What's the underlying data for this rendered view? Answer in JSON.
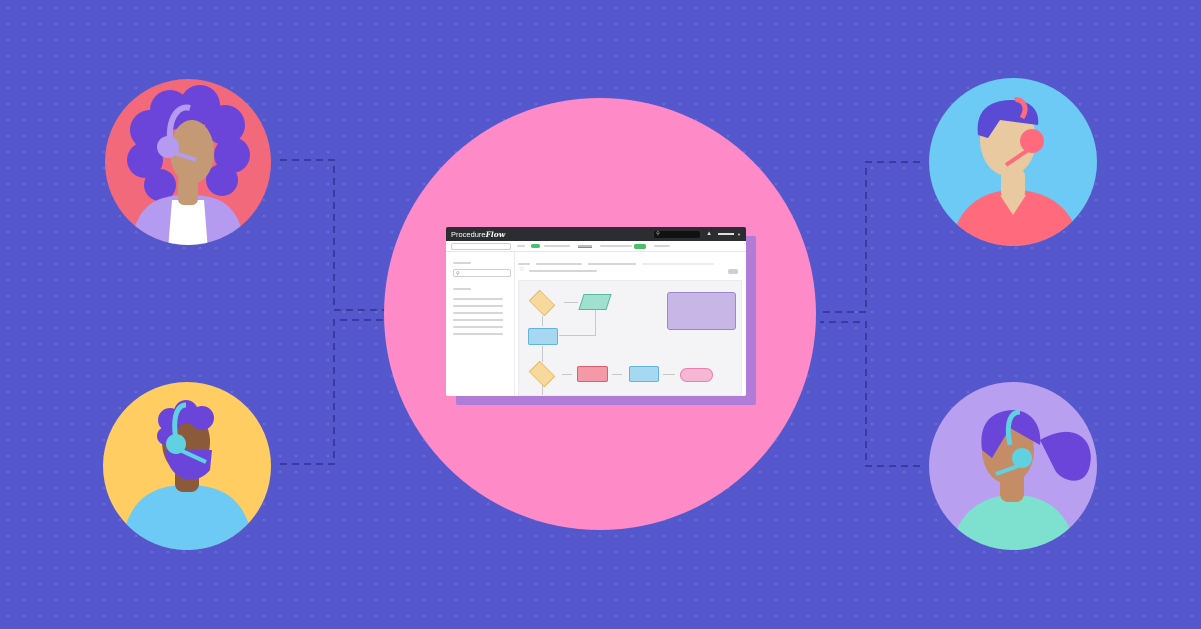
{
  "app": {
    "logo_text_a": "Procedure",
    "logo_text_b": "Flow"
  },
  "people": [
    {
      "name": "agent-top-left",
      "bg": "#f2697c"
    },
    {
      "name": "agent-bottom-left",
      "bg": "#ffcd62"
    },
    {
      "name": "agent-top-right",
      "bg": "#6ccaf5"
    },
    {
      "name": "agent-bottom-right",
      "bg": "#b99ff0"
    }
  ],
  "flowchart_shapes": [
    {
      "shape": "diamond",
      "color": "#f6d99b"
    },
    {
      "shape": "parallelogram",
      "color": "#9fe0cf"
    },
    {
      "shape": "rectangle",
      "color": "#a7d8f2"
    },
    {
      "shape": "diamond",
      "color": "#f6d99b"
    },
    {
      "shape": "rectangle",
      "color": "#f49aa6"
    },
    {
      "shape": "rectangle",
      "color": "#a7d8f2"
    },
    {
      "shape": "pill",
      "color": "#f5b7d4"
    },
    {
      "shape": "note",
      "color": "#c7b6e6"
    }
  ],
  "colors": {
    "background": "#5557cc",
    "center_circle": "#fe8ac8",
    "connector": "#3a3aa0",
    "window_shadow": "#b07cd8"
  }
}
